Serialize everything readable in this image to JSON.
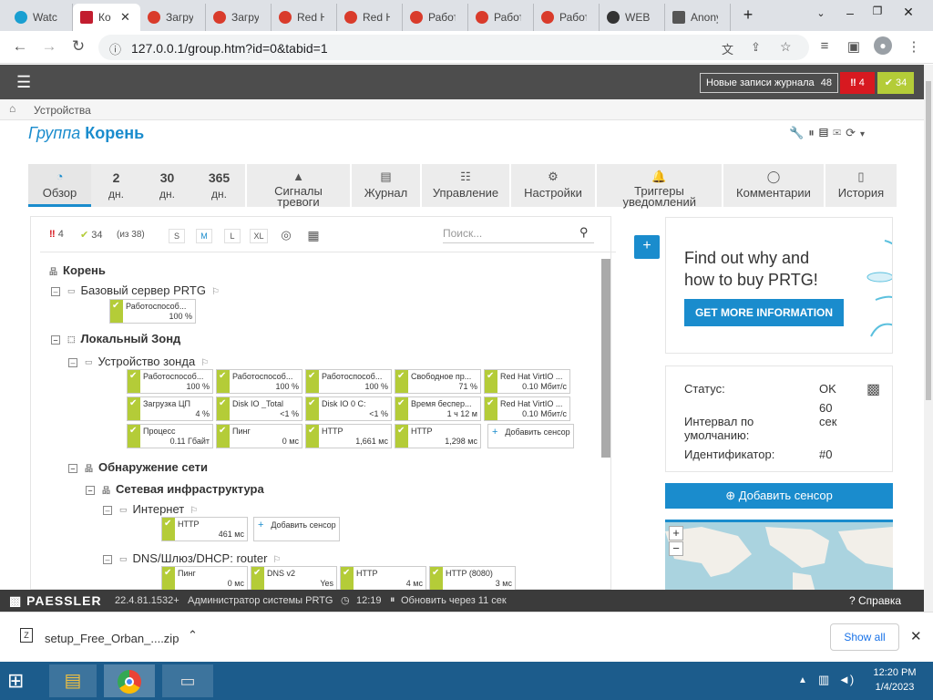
{
  "browser": {
    "tabs": [
      {
        "title": "Watc",
        "icon_color": "#1a9fd1",
        "active": false
      },
      {
        "title": "Ко",
        "icon_color": "#c21d2f",
        "active": true
      },
      {
        "title": "Загру",
        "icon_color": "#d93b2b",
        "active": false
      },
      {
        "title": "Загру",
        "icon_color": "#d93b2b",
        "active": false
      },
      {
        "title": "Red H",
        "icon_color": "#d93b2b",
        "active": false
      },
      {
        "title": "Red H",
        "icon_color": "#d93b2b",
        "active": false
      },
      {
        "title": "Работ",
        "icon_color": "#d93b2b",
        "active": false
      },
      {
        "title": "Работ",
        "icon_color": "#d93b2b",
        "active": false
      },
      {
        "title": "Работ",
        "icon_color": "#d93b2b",
        "active": false
      },
      {
        "title": "WEB и",
        "icon_color": "#333333",
        "active": false
      },
      {
        "title": "Anony",
        "icon_color": "#555555",
        "active": false
      }
    ],
    "new_tab": "+",
    "url": "127.0.0.1/group.htm?id=0&tabid=1"
  },
  "prtg": {
    "journal_label": "Новые записи журнала",
    "journal_count": "48",
    "alarms_count": "4",
    "ok_count": "34",
    "breadcrumb": "Устройства",
    "title_prefix": "Группа",
    "title_name": "Корень",
    "tabs": [
      {
        "label": "Обзор",
        "icon": "gauge-icon"
      },
      {
        "big": "2",
        "small": "дн."
      },
      {
        "big": "30",
        "small": "дн."
      },
      {
        "big": "365",
        "small": "дн."
      },
      {
        "label": "Сигналы тревоги",
        "icon": "warning-icon"
      },
      {
        "label": "Журнал",
        "icon": "log-icon"
      },
      {
        "label": "Управление",
        "icon": "sliders-icon"
      },
      {
        "label": "Настройки",
        "icon": "gear-icon"
      },
      {
        "label": "Триггеры уведомлений",
        "icon": "bell-icon"
      },
      {
        "label": "Комментарии",
        "icon": "comment-icon"
      },
      {
        "label": "История",
        "icon": "history-icon"
      }
    ],
    "toolbar": {
      "alarms": "4",
      "ok": "34",
      "of_total": "(из 38)",
      "sizes": [
        "S",
        "M",
        "L",
        "XL"
      ],
      "search_placeholder": "Поиск..."
    },
    "tree": {
      "root": "Корень",
      "base_server": "Базовый сервер PRTG",
      "local_probe": "Локальный Зонд",
      "probe_device": "Устройство зонда",
      "network_discovery": "Обнаружение сети",
      "network_infra": "Сетевая инфраструктура",
      "internet": "Интернет",
      "dns_device": "DNS/Шлюз/DHCP: router",
      "add_sensor": "Добавить сенсор"
    },
    "sensors": {
      "base": [
        {
          "name": "Работоспособ...",
          "value": "100 %"
        }
      ],
      "probe": [
        {
          "name": "Работоспособ...",
          "value": "100 %"
        },
        {
          "name": "Работоспособ...",
          "value": "100 %"
        },
        {
          "name": "Работоспособ...",
          "value": "100 %"
        },
        {
          "name": "Свободное пр...",
          "value": "71 %"
        },
        {
          "name": "Red Hat VirtIO ...",
          "value": "0.10 Мбит/с"
        },
        {
          "name": "Загрузка ЦП",
          "value": "4 %"
        },
        {
          "name": "Disk IO _Total",
          "value": "<1 %"
        },
        {
          "name": "Disk IO 0 C:",
          "value": "<1 %"
        },
        {
          "name": "Время беспер...",
          "value": "1 ч 12 м"
        },
        {
          "name": "Red Hat VirtIO ...",
          "value": "0.10 Мбит/с"
        },
        {
          "name": "Процесс",
          "value": "0.11 Гбайт"
        },
        {
          "name": "Пинг",
          "value": "0 мс"
        },
        {
          "name": "HTTP",
          "value": "1,661 мс"
        },
        {
          "name": "HTTP",
          "value": "1,298 мс"
        }
      ],
      "internet": [
        {
          "name": "HTTP",
          "value": "461 мс"
        }
      ],
      "dns": [
        {
          "name": "Пинг",
          "value": "0 мс"
        },
        {
          "name": "DNS v2",
          "value": "Yes"
        },
        {
          "name": "HTTP",
          "value": "4 мс"
        },
        {
          "name": "HTTP (8080)",
          "value": "3 мс"
        }
      ]
    },
    "ad": {
      "headline": "Find out why and how to buy PRTG!",
      "button": "GET MORE INFORMATION"
    },
    "status_box": {
      "status_label": "Статус:",
      "status_value": "OK",
      "interval_label": "Интервал по умолчанию:",
      "interval_value": "60 сек",
      "id_label": "Идентификатор:",
      "id_value": "#0"
    },
    "add_sensor_button": "Добавить сенсор",
    "footer": {
      "logo": "PAESSLER",
      "version": "22.4.81.1532+",
      "user": "Администратор системы PRTG",
      "time": "12:19",
      "refresh": "Обновить через 11 сек",
      "help": "Справка"
    }
  },
  "downloads": {
    "file": "setup_Free_Orban_....zip",
    "show_all": "Show all"
  },
  "taskbar": {
    "time": "12:20 PM",
    "date": "1/4/2023"
  },
  "colors": {
    "accent": "#1a8ccd",
    "ok": "#b4cc38",
    "alarm": "#d71920",
    "header": "#4d4d4d"
  }
}
